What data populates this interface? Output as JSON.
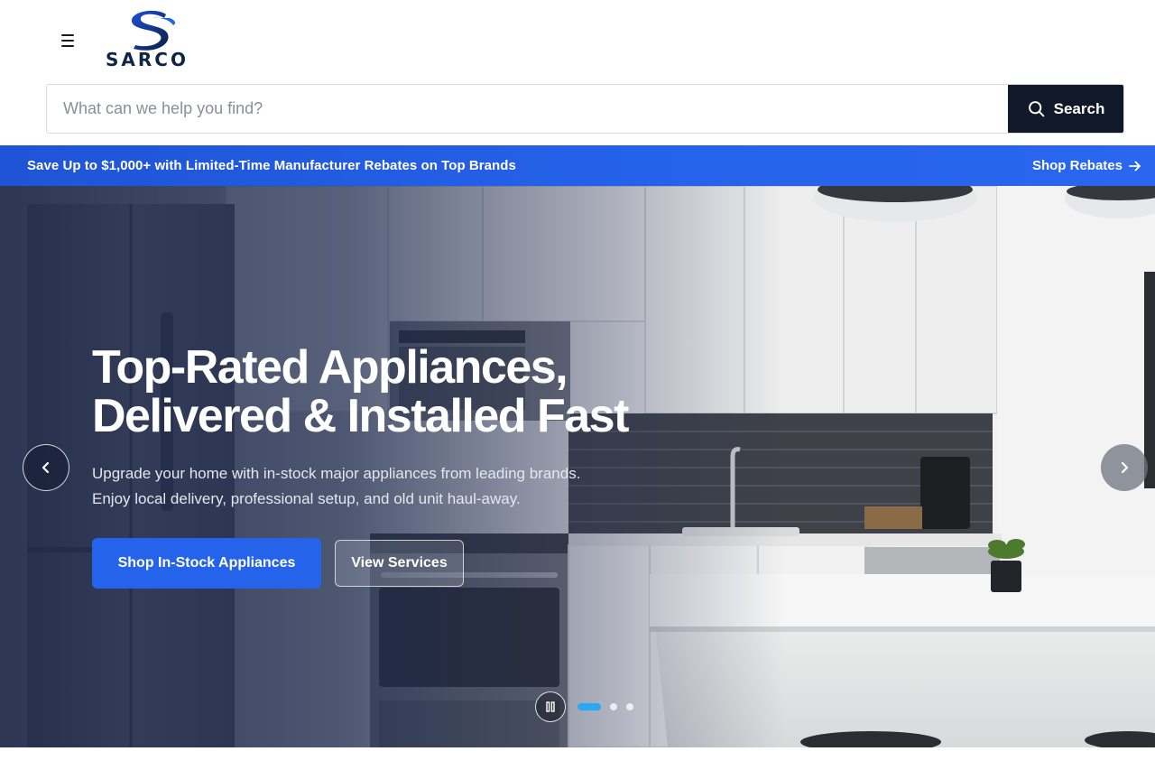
{
  "header": {
    "brand_name": "SARCO",
    "menu_icon": "hamburger-menu-icon"
  },
  "search": {
    "placeholder": "What can we help you find?",
    "value": "",
    "button_label": "Search",
    "icon": "search-icon"
  },
  "promo": {
    "text": "Save Up to $1,000+ with Limited-Time Manufacturer Rebates on Top Brands",
    "link_label": "Shop Rebates",
    "link_icon": "arrow-right-icon"
  },
  "hero": {
    "title_line1": "Top-Rated Appliances,",
    "title_line2": "Delivered & Installed Fast",
    "subtitle_line1": "Upgrade your home with in-stock major appliances from leading brands.",
    "subtitle_line2": "Enjoy local delivery, professional setup, and old unit haul-away.",
    "primary_cta": "Shop In-Stock Appliances",
    "secondary_cta": "View Services",
    "slide_count": 3,
    "active_slide": 1,
    "prev_icon": "chevron-left-icon",
    "next_icon": "chevron-right-icon",
    "pause_icon": "pause-icon"
  },
  "colors": {
    "accent": "#2563eb",
    "search_button": "#111827",
    "active_dot": "#29a8f3",
    "brand_navy": "#0f2547"
  }
}
